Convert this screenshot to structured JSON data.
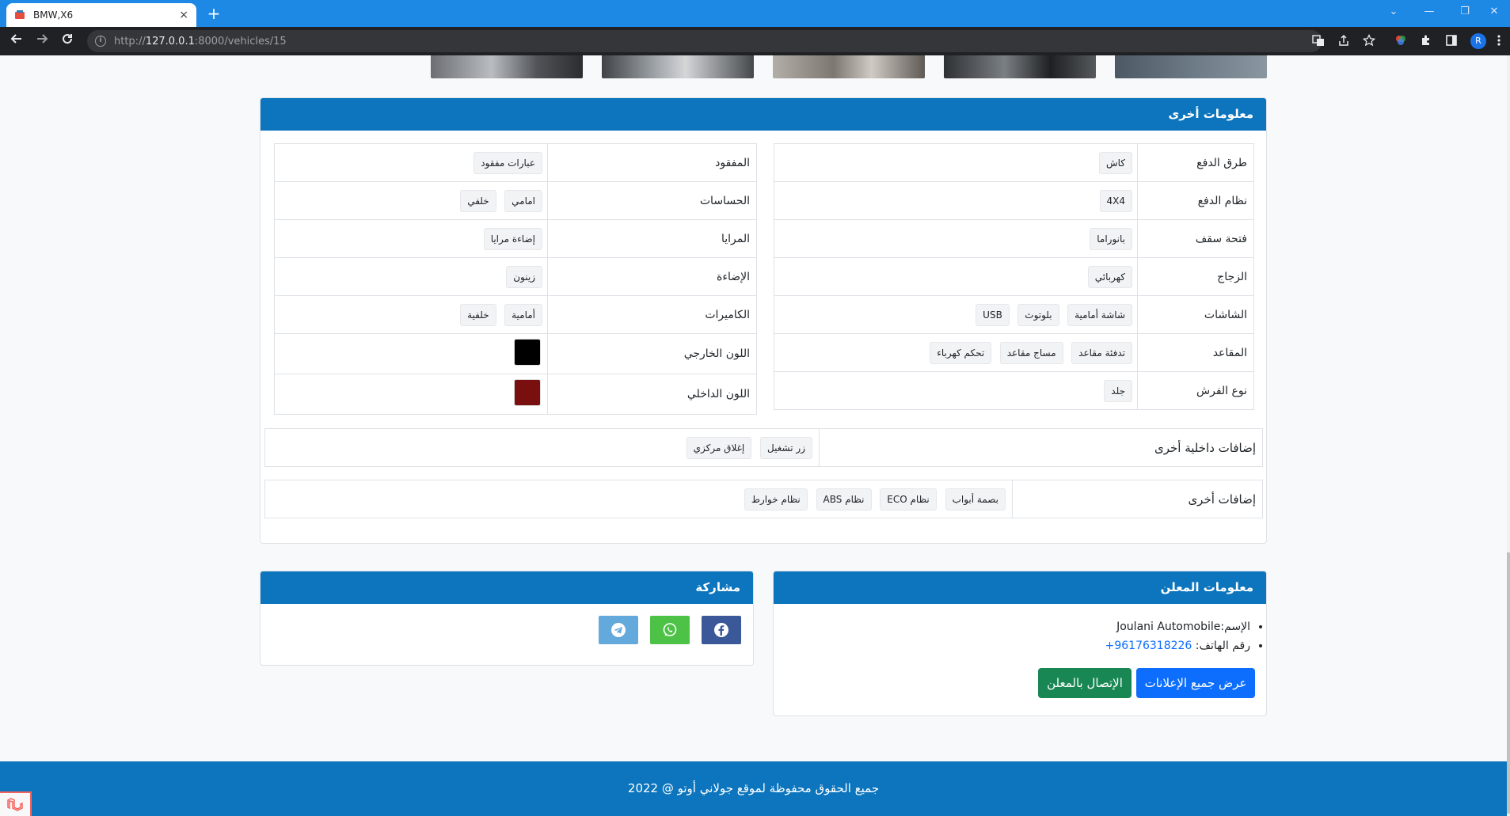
{
  "browser": {
    "tab_title": "BMW,X6",
    "tab_close": "×",
    "new_tab": "+",
    "url_scheme": "http://",
    "url_host": "127.0.0.1",
    "url_path": ":8000/vehicles/15",
    "profile_initial": "R",
    "window_controls": [
      "⌄",
      "—",
      "❐",
      "✕"
    ]
  },
  "other_info": {
    "title": "معلومات أخرى",
    "right_table": [
      {
        "label": "طرق الدفع",
        "values": [
          "كاش"
        ]
      },
      {
        "label": "نظام الدفع",
        "values": [
          "4X4"
        ]
      },
      {
        "label": "فتحة سقف",
        "values": [
          "بانوراما"
        ]
      },
      {
        "label": "الزجاج",
        "values": [
          "كهربائي"
        ]
      },
      {
        "label": "الشاشات",
        "values": [
          "شاشة أمامية",
          "بلوتوث",
          "USB"
        ]
      },
      {
        "label": "المقاعد",
        "values": [
          "تدفئة مقاعد",
          "مساج مقاعد",
          "تحكم كهرباء"
        ]
      },
      {
        "label": "نوع الفرش",
        "values": [
          "جلد"
        ]
      }
    ],
    "left_table": [
      {
        "label": "المفقود",
        "values": [
          "عبارات مفقود"
        ]
      },
      {
        "label": "الحساسات",
        "values": [
          "امامي",
          "خلفي"
        ]
      },
      {
        "label": "المرايا",
        "values": [
          "إضاءة مرايا"
        ]
      },
      {
        "label": "الإضاءة",
        "values": [
          "زينون"
        ]
      },
      {
        "label": "الكاميرات",
        "values": [
          "أمامية",
          "خلفية"
        ]
      }
    ],
    "colors": [
      {
        "label": "اللون الخارجي",
        "color": "#000000"
      },
      {
        "label": "اللون الداخلي",
        "color": "#7a0f0f"
      }
    ],
    "interior_extras": {
      "label": "إضافات داخلية أخرى",
      "values": [
        "زر تشغيل",
        "إغلاق مركزي"
      ]
    },
    "other_extras": {
      "label": "إضافات أخرى",
      "values": [
        "بصمة أبواب",
        "نظام ECO",
        "نظام ABS",
        "نظام خوارط"
      ]
    }
  },
  "advertiser": {
    "title": "معلومات المعلن",
    "name_label": "الإسم:",
    "name": "Joulani Automobile",
    "phone_label": "رقم الهاتف:",
    "phone": "+96176318226",
    "all_ads_button": "عرض جميع الإعلانات",
    "contact_button": "الإتصال بالمعلن"
  },
  "share": {
    "title": "مشاركة",
    "buttons": [
      {
        "name": "facebook",
        "color": "#3b5998"
      },
      {
        "name": "whatsapp",
        "color": "#4dc247"
      },
      {
        "name": "telegram",
        "color": "#64a9dc"
      }
    ]
  },
  "footer": {
    "text": "جميع الحقوق محفوظة لموقع جولاني أوتو @ 2022"
  },
  "colors": {
    "brand": "#0c75bd",
    "primary_button": "#0d6efd",
    "success_button": "#198754"
  }
}
